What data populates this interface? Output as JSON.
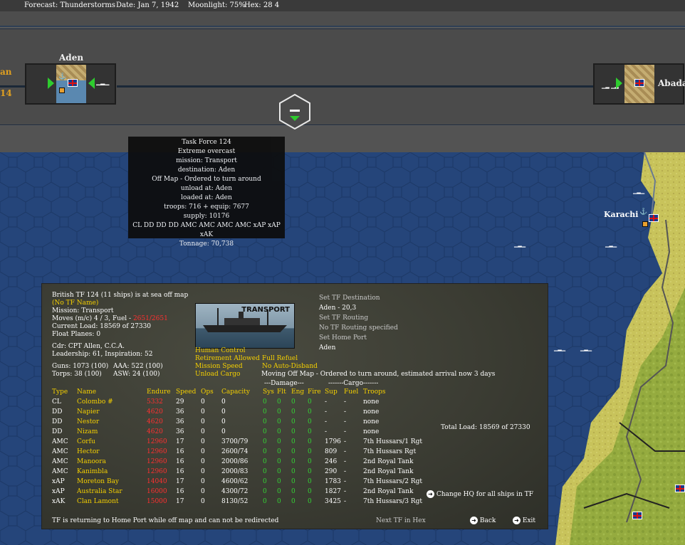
{
  "topbar": {
    "forecast": "Forecast: Thunderstorms",
    "date": "Date: Jan 7, 1942",
    "moonlight": "Moonlight: 75%",
    "hex": "Hex: 28 4"
  },
  "strip": {
    "left_edge_name": "an",
    "left_edge_num": "14",
    "port_left": "Aden",
    "port_right": "Abada",
    "tf_icon": "task-force-icon"
  },
  "map_labels": {
    "karachi": "Karachi"
  },
  "tooltip": {
    "lines": [
      "Task Force 124",
      "Extreme overcast",
      "mission: Transport",
      "destination: Aden",
      "Off Map - Ordered to turn around",
      "unload at: Aden",
      "loaded at: Aden",
      "troops: 716 + equip: 7677",
      "supply: 10176",
      "CL DD DD DD AMC AMC AMC AMC xAP xAP xAK",
      "Tonnage: 70,738"
    ]
  },
  "panel": {
    "header": "British TF 124 (11 ships) is at sea off map",
    "tf_name": "(No TF Name)",
    "mission": "Mission: Transport",
    "moves_prefix": "Moves (m/c) 4 / 3, Fuel - ",
    "moves_fuel": "2651/2651",
    "current_load": "Current Load: 18569 of 27330",
    "float_planes": "Float Planes: 0",
    "cdr": "Cdr: CPT Allen, C.C.A.",
    "leadership": "Leadership: 61, Inspiration: 52",
    "guns": "Guns: 1073 (100)",
    "aaa": "AAA: 522 (100)",
    "torps": "Torps: 38 (100)",
    "asw": "ASW: 24 (100)",
    "image_label": "TRANSPORT",
    "options_left": [
      "Human Control",
      "Retirement Allowed",
      "Mission Speed",
      "Unload Cargo"
    ],
    "options_right": [
      "Full Refuel",
      "No Auto-Disband"
    ],
    "set_dest": "Set TF Destination",
    "dest_value": "Aden - 20,3",
    "set_routing": "Set TF Routing",
    "routing_value": "No TF Routing specified",
    "set_home": "Set Home Port",
    "home_value": "Aden",
    "status_msg": "Moving Off Map - Ordered to turn around, estimated arrival now 3 days",
    "damage_group": "---Damage---",
    "cargo_group": "-------Cargo-------",
    "columns": [
      "Type",
      "Name",
      "Endure",
      "Speed",
      "Ops",
      "Capacity",
      "Sys",
      "Flt",
      "Eng",
      "Fire",
      "Sup",
      "Fuel",
      "Troops"
    ],
    "ships": [
      {
        "type": "CL",
        "name": "Colombo #",
        "endure": "5332",
        "speed": "29",
        "ops": "0",
        "capacity": "0",
        "sys": "0",
        "flt": "0",
        "eng": "0",
        "fire": "0",
        "sup": "-",
        "fuel": "-",
        "troops": "none"
      },
      {
        "type": "DD",
        "name": "Napier",
        "endure": "4620",
        "speed": "36",
        "ops": "0",
        "capacity": "0",
        "sys": "0",
        "flt": "0",
        "eng": "0",
        "fire": "0",
        "sup": "-",
        "fuel": "-",
        "troops": "none"
      },
      {
        "type": "DD",
        "name": "Nestor",
        "endure": "4620",
        "speed": "36",
        "ops": "0",
        "capacity": "0",
        "sys": "0",
        "flt": "0",
        "eng": "0",
        "fire": "0",
        "sup": "-",
        "fuel": "-",
        "troops": "none"
      },
      {
        "type": "DD",
        "name": "Nizam",
        "endure": "4620",
        "speed": "36",
        "ops": "0",
        "capacity": "0",
        "sys": "0",
        "flt": "0",
        "eng": "0",
        "fire": "0",
        "sup": "-",
        "fuel": "-",
        "troops": "none"
      },
      {
        "type": "AMC",
        "name": "Corfu",
        "endure": "12960",
        "speed": "17",
        "ops": "0",
        "capacity": "3700/79",
        "sys": "0",
        "flt": "0",
        "eng": "0",
        "fire": "0",
        "sup": "1796",
        "fuel": "-",
        "troops": "7th Hussars/1 Rgt"
      },
      {
        "type": "AMC",
        "name": "Hector",
        "endure": "12960",
        "speed": "16",
        "ops": "0",
        "capacity": "2600/74",
        "sys": "0",
        "flt": "0",
        "eng": "0",
        "fire": "0",
        "sup": "809",
        "fuel": "-",
        "troops": "7th Hussars Rgt"
      },
      {
        "type": "AMC",
        "name": "Manoora",
        "endure": "12960",
        "speed": "16",
        "ops": "0",
        "capacity": "2000/86",
        "sys": "0",
        "flt": "0",
        "eng": "0",
        "fire": "0",
        "sup": "246",
        "fuel": "-",
        "troops": "2nd Royal Tank"
      },
      {
        "type": "AMC",
        "name": "Kanimbla",
        "endure": "12960",
        "speed": "16",
        "ops": "0",
        "capacity": "2000/83",
        "sys": "0",
        "flt": "0",
        "eng": "0",
        "fire": "0",
        "sup": "290",
        "fuel": "-",
        "troops": "2nd Royal Tank"
      },
      {
        "type": "xAP",
        "name": "Moreton Bay",
        "endure": "14040",
        "speed": "17",
        "ops": "0",
        "capacity": "4600/62",
        "sys": "0",
        "flt": "0",
        "eng": "0",
        "fire": "0",
        "sup": "1783",
        "fuel": "-",
        "troops": "7th Hussars/2 Rgt"
      },
      {
        "type": "xAP",
        "name": "Australia Star",
        "endure": "16000",
        "speed": "16",
        "ops": "0",
        "capacity": "4300/72",
        "sys": "0",
        "flt": "0",
        "eng": "0",
        "fire": "0",
        "sup": "1827",
        "fuel": "-",
        "troops": "2nd Royal Tank"
      },
      {
        "type": "xAK",
        "name": "Clan Lamont",
        "endure": "15000",
        "speed": "17",
        "ops": "0",
        "capacity": "8130/52",
        "sys": "0",
        "flt": "0",
        "eng": "0",
        "fire": "0",
        "sup": "3425",
        "fuel": "-",
        "troops": "7th Hussars/3 Rgt"
      }
    ],
    "total_load": "Total Load: 18569 of 27330",
    "change_hq": "Change HQ for all ships in TF",
    "footer_msg": "TF is returning to Home Port while off map and can not be redirected",
    "next_tf": "Next TF in Hex",
    "back": "Back",
    "exit": "Exit"
  },
  "colors": {
    "ocean": "#25457a",
    "land": "#c9c25a",
    "highlight_yellow": "#f5d000",
    "endure_red": "#ff3030",
    "damage_green": "#34d034"
  }
}
